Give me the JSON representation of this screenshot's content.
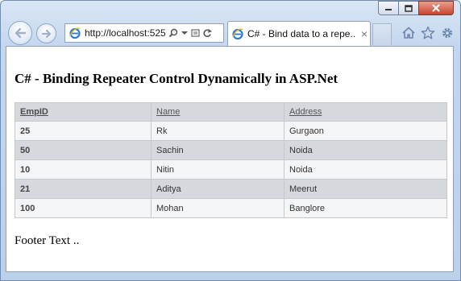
{
  "browser": {
    "url": "http://localhost:525",
    "tab_title": "C# - Bind data to a repe...",
    "tab_close": "×"
  },
  "page": {
    "heading": "C# - Binding Repeater Control Dynamically in ASP.Net",
    "table": {
      "headers": [
        "EmpID",
        "Name",
        "Address"
      ],
      "rows": [
        [
          "25",
          "Rk",
          "Gurgaon"
        ],
        [
          "50",
          "Sachin",
          "Noida"
        ],
        [
          "10",
          "Nitin",
          "Noida"
        ],
        [
          "21",
          "Aditya",
          "Meerut"
        ],
        [
          "100",
          "Mohan",
          "Banglore"
        ]
      ]
    },
    "footer": "Footer Text .."
  },
  "icons": {
    "back": "back-arrow-icon",
    "forward": "forward-arrow-icon",
    "page": "ie-logo-icon",
    "search": "search-icon",
    "dropdown": "chevron-down-icon",
    "compat": "compatibility-view-icon",
    "refresh": "refresh-icon",
    "home": "home-icon",
    "favorites": "star-icon",
    "tools": "gear-icon",
    "minimize": "minimize-icon",
    "maximize": "maximize-icon",
    "close": "close-icon"
  },
  "colors": {
    "frame": "#c3d6ee",
    "close_button": "#c8442e",
    "row_alt": "#d5d9de",
    "row_normal": "#f4f5f7"
  }
}
